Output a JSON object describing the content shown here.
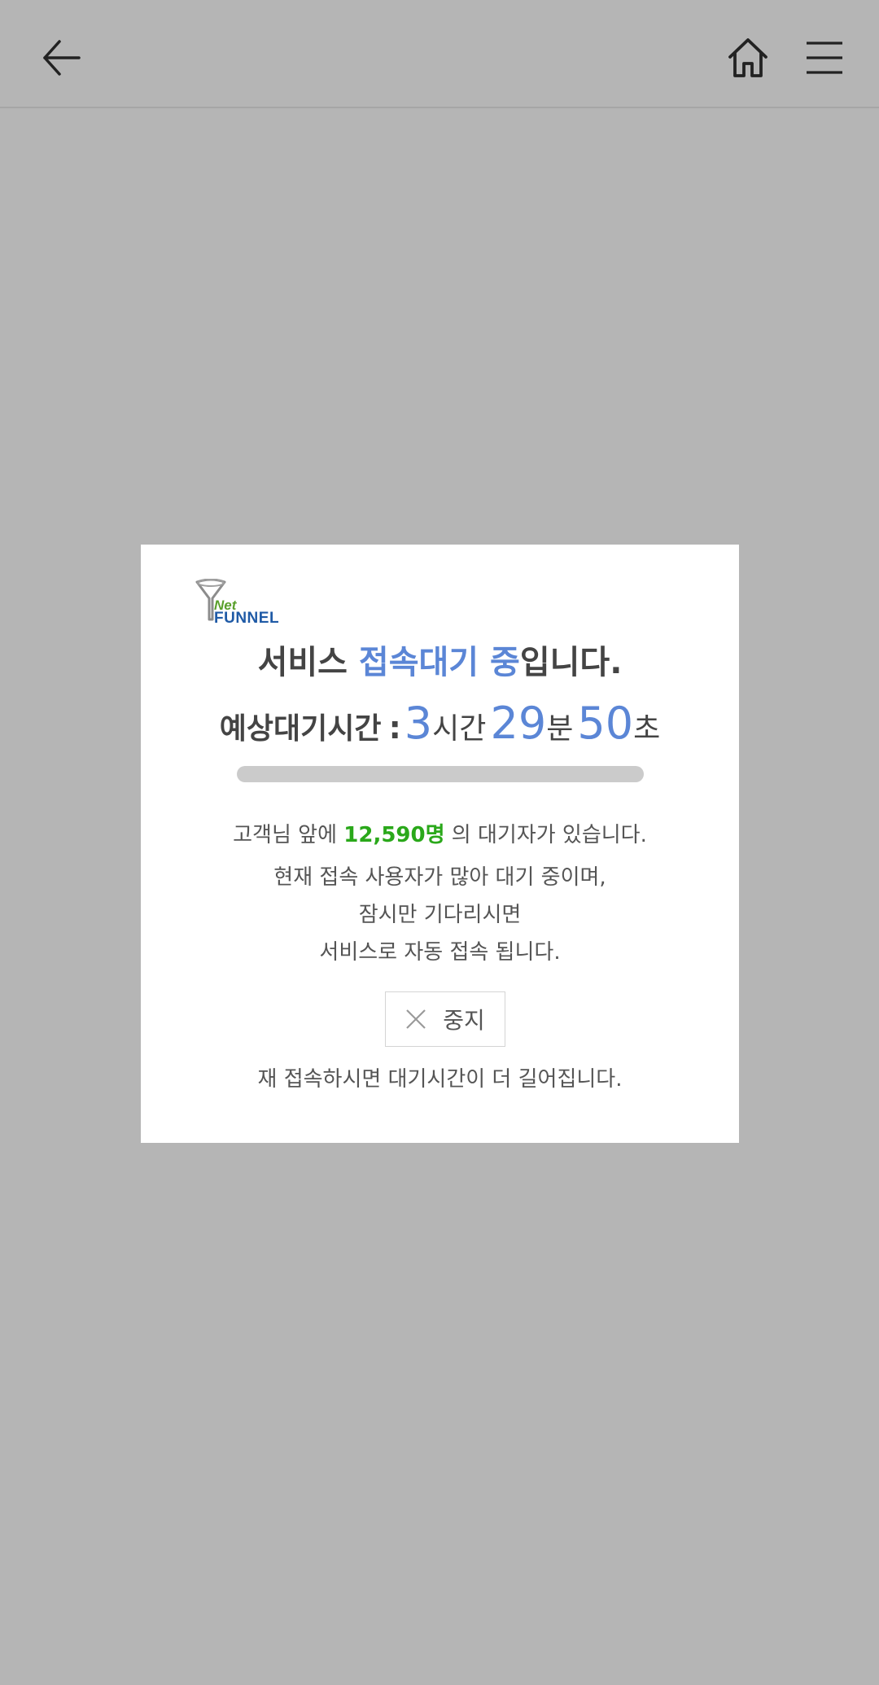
{
  "header": {
    "back_icon": "arrow-left-icon",
    "home_icon": "home-icon",
    "menu_icon": "hamburger-menu-icon"
  },
  "modal": {
    "logo": {
      "net": "Net",
      "funnel": "FUNNEL"
    },
    "title": {
      "prefix": "서비스 ",
      "highlight": "접속대기 중",
      "suffix": "입니다."
    },
    "wait_time": {
      "label": "예상대기시간",
      "colon": ":",
      "hours": "3",
      "hours_unit": "시간",
      "minutes": "29",
      "minutes_unit": "분",
      "seconds": "50",
      "seconds_unit": "초"
    },
    "progress_percent": 0,
    "queue": {
      "prefix": "고객님 앞에 ",
      "count": "12,590명",
      "suffix": " 의 대기자가 있습니다."
    },
    "message_lines": [
      "현재 접속 사용자가 많아 대기 중이며,",
      "잠시만 기다리시면",
      "서비스로 자동 접속 됩니다."
    ],
    "stop_button": {
      "icon": "close-icon",
      "label": "중지"
    },
    "reconnect_notice": "재 접속하시면 대기시간이 더 길어집니다."
  },
  "colors": {
    "backdrop": "#b5b5b5",
    "accent_blue": "#5b86d6",
    "accent_green": "#2aa81a",
    "text": "#444444"
  }
}
